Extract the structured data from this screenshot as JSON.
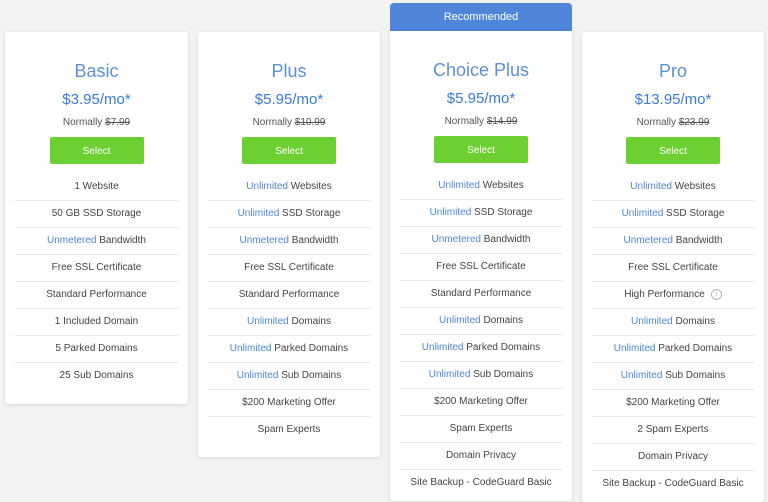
{
  "recommended_badge": "Recommended",
  "plans": [
    {
      "name": "Basic",
      "price": "$3.95/mo*",
      "normally_label": "Normally",
      "normally_price": "$7.99",
      "select_label": "Select",
      "features": [
        {
          "hl": "",
          "text": "1 Website"
        },
        {
          "hl": "",
          "text": "50 GB SSD Storage"
        },
        {
          "hl": "Unmetered",
          "text": " Bandwidth"
        },
        {
          "hl": "",
          "text": "Free SSL Certificate"
        },
        {
          "hl": "",
          "text": "Standard Performance"
        },
        {
          "hl": "",
          "text": "1 Included Domain"
        },
        {
          "hl": "",
          "text": "5 Parked Domains"
        },
        {
          "hl": "",
          "text": "25 Sub Domains"
        }
      ]
    },
    {
      "name": "Plus",
      "price": "$5.95/mo*",
      "normally_label": "Normally",
      "normally_price": "$10.99",
      "select_label": "Select",
      "features": [
        {
          "hl": "Unlimited",
          "text": " Websites"
        },
        {
          "hl": "Unlimited",
          "text": " SSD Storage"
        },
        {
          "hl": "Unmetered",
          "text": " Bandwidth"
        },
        {
          "hl": "",
          "text": "Free SSL Certificate"
        },
        {
          "hl": "",
          "text": "Standard Performance"
        },
        {
          "hl": "Unlimited",
          "text": " Domains"
        },
        {
          "hl": "Unlimited",
          "text": " Parked Domains"
        },
        {
          "hl": "Unlimited",
          "text": " Sub Domains"
        },
        {
          "hl": "",
          "text": "$200 Marketing Offer"
        },
        {
          "hl": "",
          "text": "Spam Experts"
        }
      ]
    },
    {
      "name": "Choice Plus",
      "price": "$5.95/mo*",
      "normally_label": "Normally",
      "normally_price": "$14.99",
      "select_label": "Select",
      "features": [
        {
          "hl": "Unlimited",
          "text": " Websites"
        },
        {
          "hl": "Unlimited",
          "text": " SSD Storage"
        },
        {
          "hl": "Unmetered",
          "text": " Bandwidth"
        },
        {
          "hl": "",
          "text": "Free SSL Certificate"
        },
        {
          "hl": "",
          "text": "Standard Performance"
        },
        {
          "hl": "Unlimited",
          "text": " Domains"
        },
        {
          "hl": "Unlimited",
          "text": " Parked Domains"
        },
        {
          "hl": "Unlimited",
          "text": " Sub Domains"
        },
        {
          "hl": "",
          "text": "$200 Marketing Offer"
        },
        {
          "hl": "",
          "text": "Spam Experts"
        },
        {
          "hl": "",
          "text": "Domain Privacy"
        },
        {
          "hl": "",
          "text": "Site Backup - CodeGuard Basic"
        }
      ]
    },
    {
      "name": "Pro",
      "price": "$13.95/mo*",
      "normally_label": "Normally",
      "normally_price": "$23.99",
      "select_label": "Select",
      "features": [
        {
          "hl": "Unlimited",
          "text": " Websites"
        },
        {
          "hl": "Unlimited",
          "text": " SSD Storage"
        },
        {
          "hl": "Unmetered",
          "text": " Bandwidth"
        },
        {
          "hl": "",
          "text": "Free SSL Certificate"
        },
        {
          "hl": "",
          "text": "High Performance",
          "info_icon": "info-icon"
        },
        {
          "hl": "Unlimited",
          "text": " Domains"
        },
        {
          "hl": "Unlimited",
          "text": " Parked Domains"
        },
        {
          "hl": "Unlimited",
          "text": " Sub Domains"
        },
        {
          "hl": "",
          "text": "$200 Marketing Offer"
        },
        {
          "hl": "",
          "text": "2 Spam Experts"
        },
        {
          "hl": "",
          "text": "Domain Privacy"
        },
        {
          "hl": "",
          "text": "Site Backup - CodeGuard Basic"
        }
      ]
    }
  ],
  "colors": {
    "accent_blue": "#4f86d9",
    "select_green": "#6cd033"
  }
}
